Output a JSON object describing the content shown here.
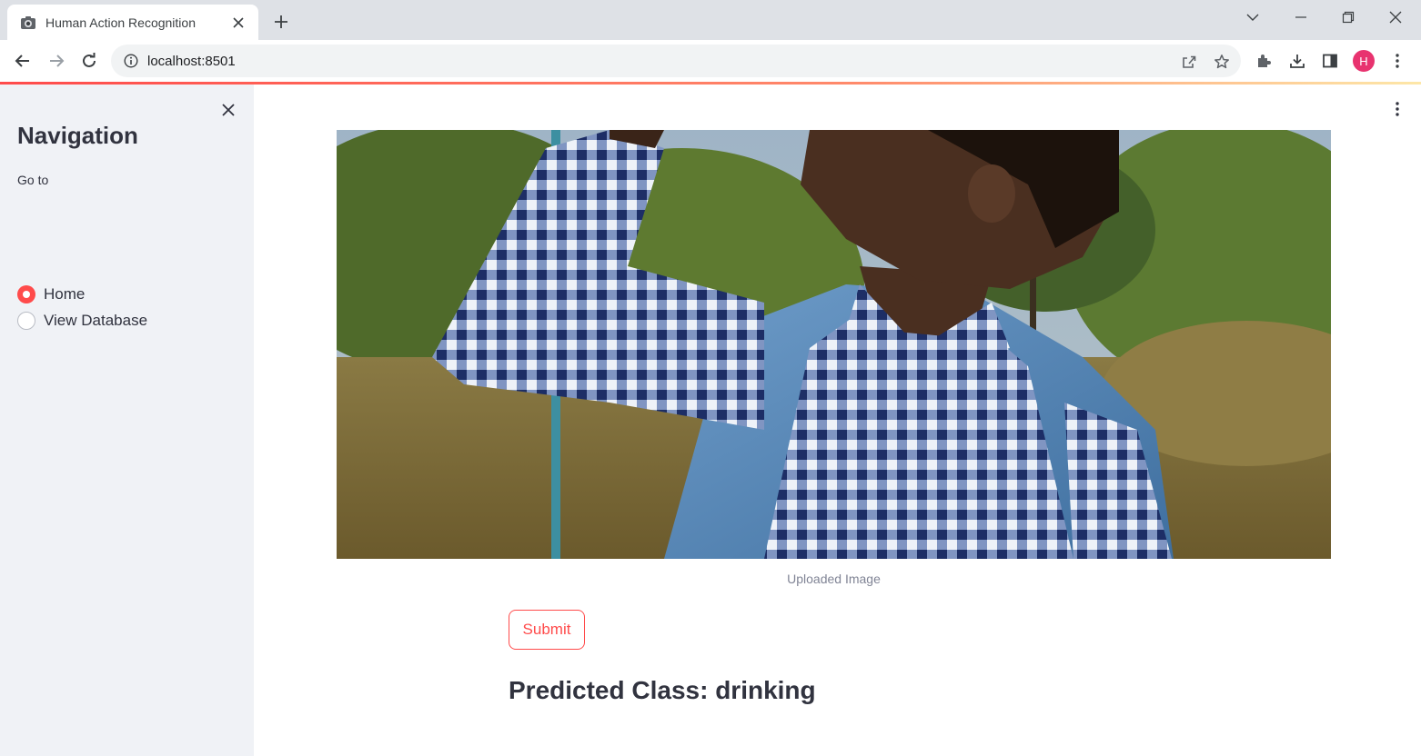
{
  "browser": {
    "tab_title": "Human Action Recognition",
    "url": "localhost:8501",
    "profile_initial": "H"
  },
  "sidebar": {
    "title": "Navigation",
    "radio_label": "Go to",
    "options": [
      {
        "label": "Home",
        "selected": true
      },
      {
        "label": "View Database",
        "selected": false
      }
    ]
  },
  "main": {
    "image_caption": "Uploaded Image",
    "submit_label": "Submit",
    "prediction_text": "Predicted Class: drinking"
  },
  "colors": {
    "accent": "#ff4b4b",
    "sidebar_bg": "#f0f2f6",
    "text": "#31333f",
    "avatar": "#e8336f"
  }
}
